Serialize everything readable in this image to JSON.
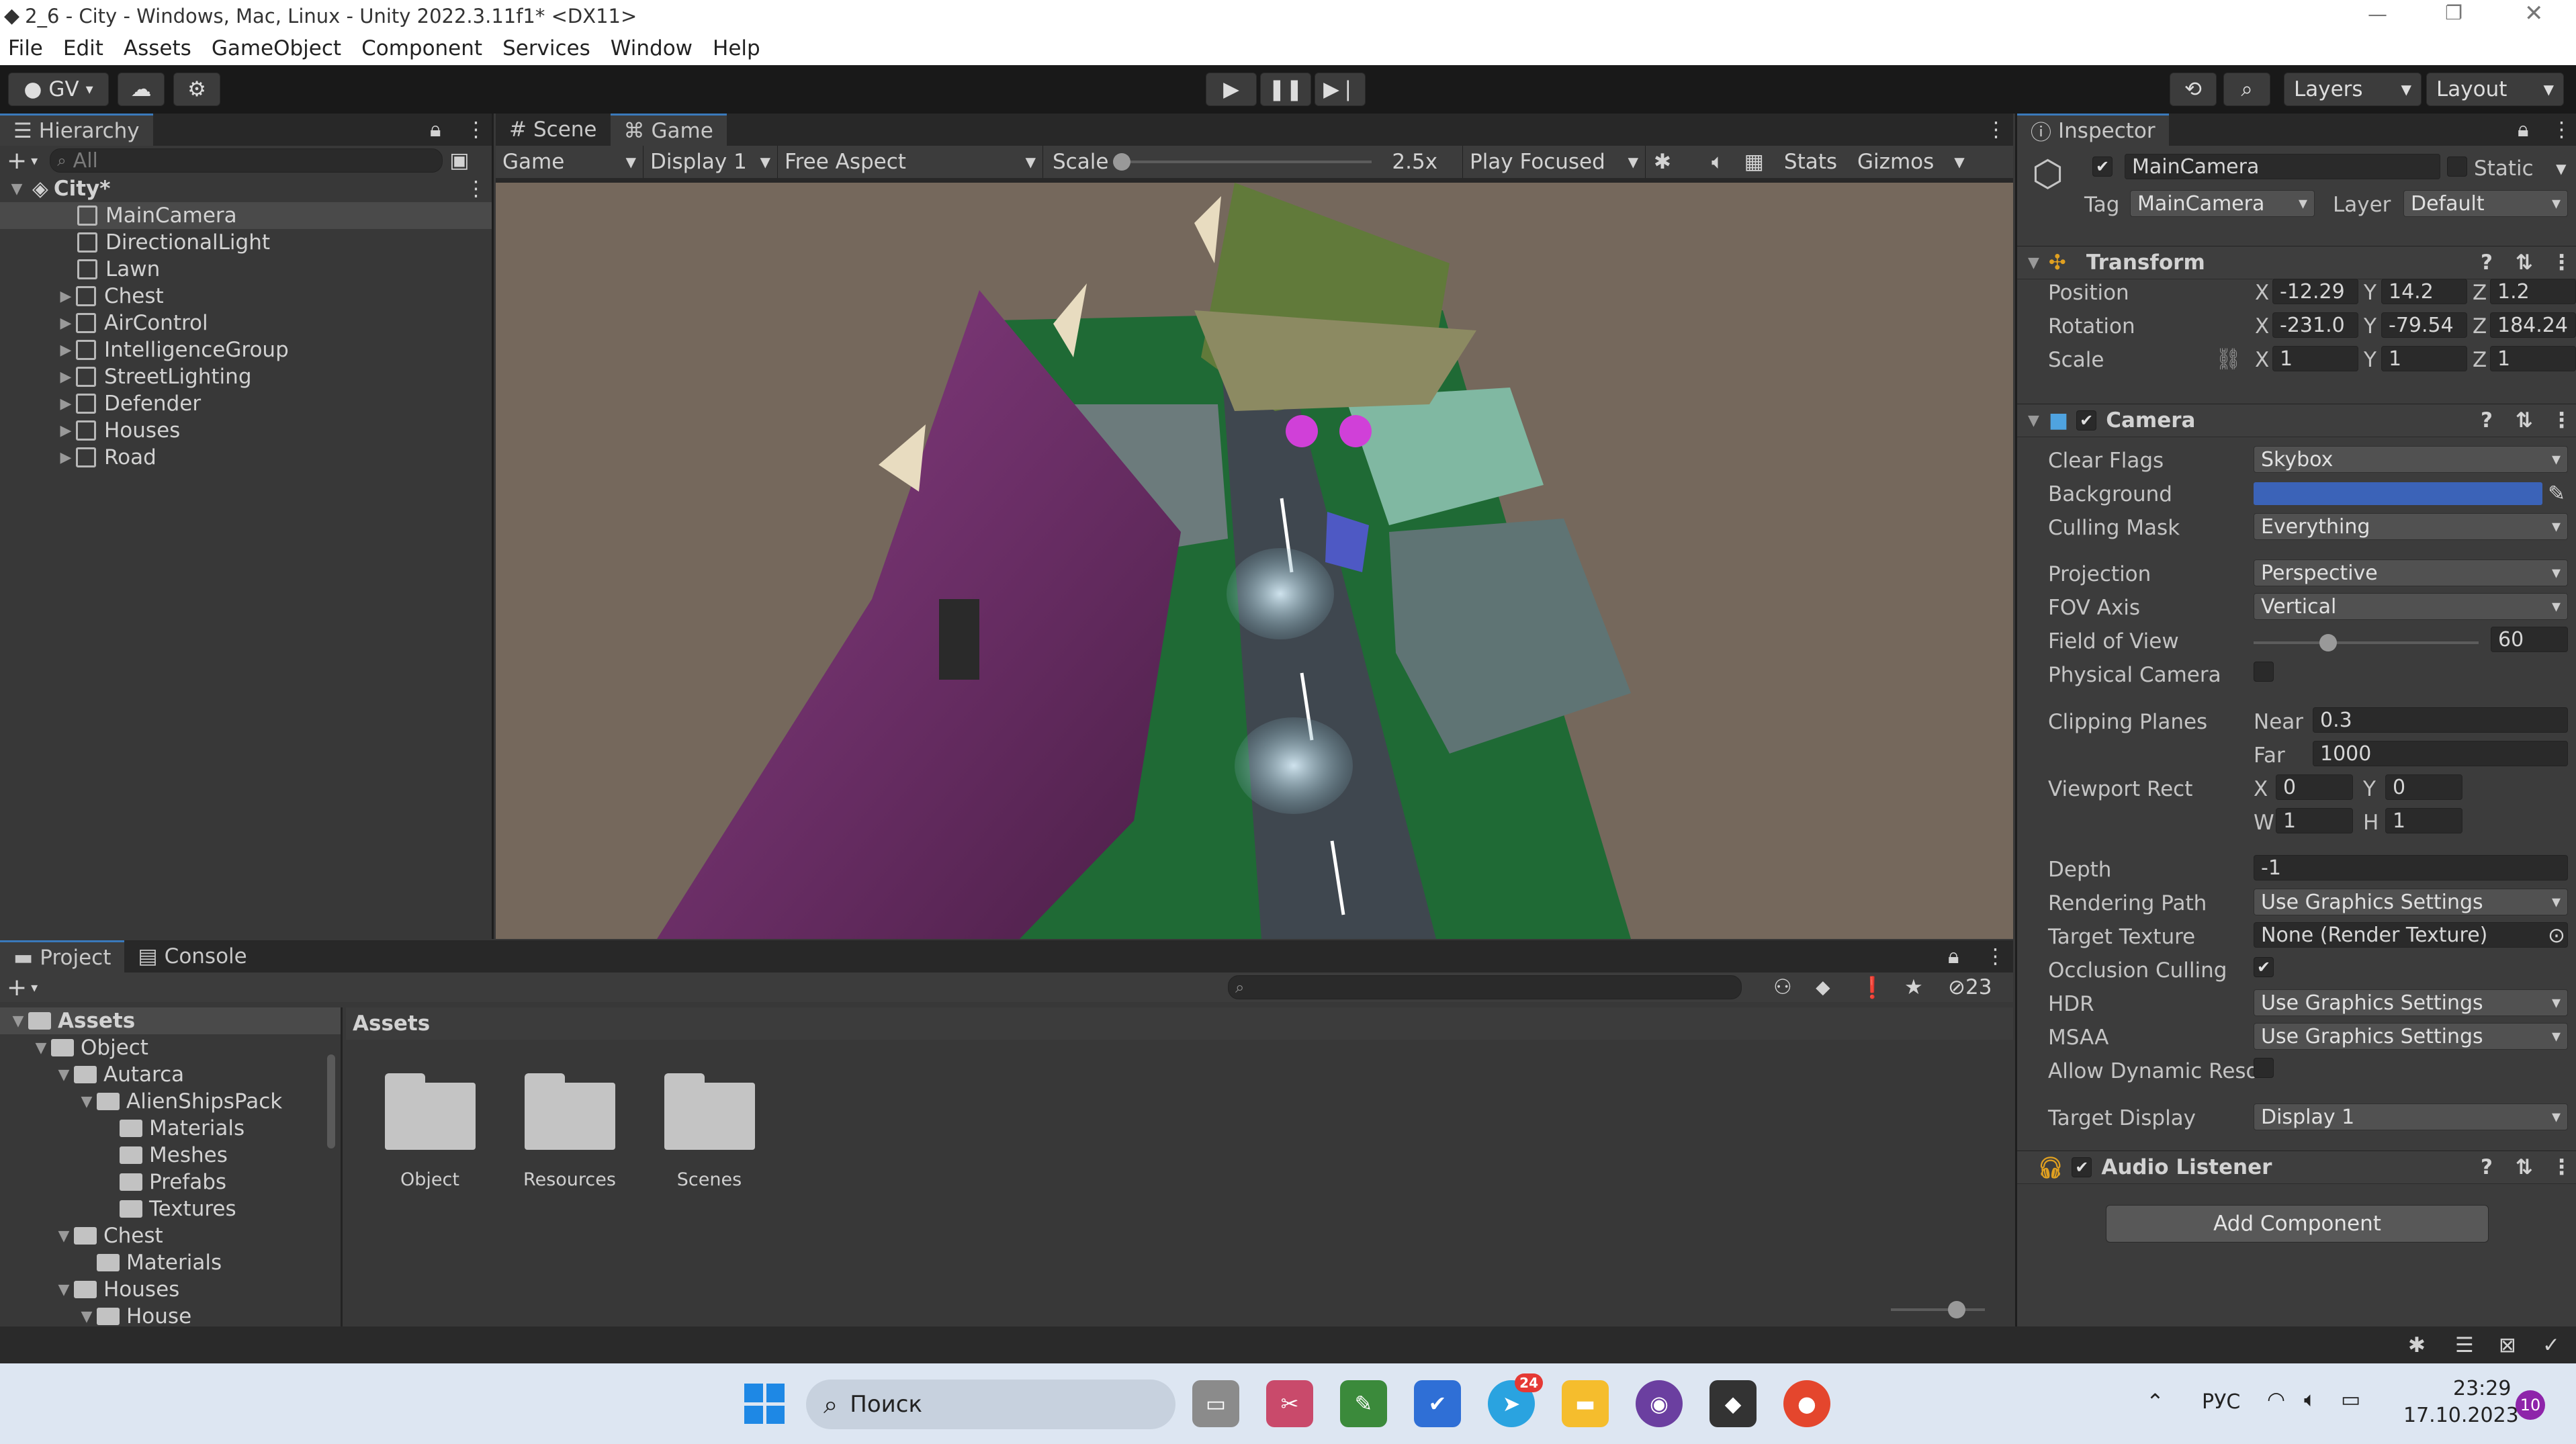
{
  "window": {
    "title": "2_6 - City - Windows, Mac, Linux - Unity 2022.3.11f1* <DX11>"
  },
  "menu": [
    "File",
    "Edit",
    "Assets",
    "GameObject",
    "Component",
    "Services",
    "Window",
    "Help"
  ],
  "toolbar": {
    "account": "GV",
    "layers": "Layers",
    "layout": "Layout"
  },
  "hierarchy": {
    "tab": "Hierarchy",
    "search_placeholder": "All",
    "scene": "City*",
    "items": [
      {
        "label": "MainCamera",
        "expandable": false
      },
      {
        "label": "DirectionalLight",
        "expandable": false
      },
      {
        "label": "Lawn",
        "expandable": false
      },
      {
        "label": "Chest",
        "expandable": true
      },
      {
        "label": "AirControl",
        "expandable": true
      },
      {
        "label": "IntelligenceGroup",
        "expandable": true
      },
      {
        "label": "StreetLighting",
        "expandable": true
      },
      {
        "label": "Defender",
        "expandable": true
      },
      {
        "label": "Houses",
        "expandable": true
      },
      {
        "label": "Road",
        "expandable": true
      }
    ]
  },
  "view": {
    "tabs": [
      "Scene",
      "Game"
    ],
    "game_dropdown": "Game",
    "display": "Display 1",
    "aspect": "Free Aspect",
    "scale_label": "Scale",
    "scale_value": "2.5x",
    "scale_level": 0.0,
    "play_mode": "Play Focused",
    "stats": "Stats",
    "gizmos": "Gizmos"
  },
  "inspector": {
    "tab": "Inspector",
    "object_name": "MainCamera",
    "static_label": "Static",
    "tag_label": "Tag",
    "tag": "MainCamera",
    "layer_label": "Layer",
    "layer": "Default",
    "transform": {
      "title": "Transform",
      "position": {
        "label": "Position",
        "x": "-12.29",
        "y": "14.2",
        "z": "1.2"
      },
      "rotation": {
        "label": "Rotation",
        "x": "-231.0",
        "y": "-79.54",
        "z": "184.24"
      },
      "scale": {
        "label": "Scale",
        "x": "1",
        "y": "1",
        "z": "1"
      }
    },
    "camera": {
      "title": "Camera",
      "clear_flags": {
        "label": "Clear Flags",
        "value": "Skybox"
      },
      "background": {
        "label": "Background",
        "color": "#3b63b8"
      },
      "culling_mask": {
        "label": "Culling Mask",
        "value": "Everything"
      },
      "projection": {
        "label": "Projection",
        "value": "Perspective"
      },
      "fov_axis": {
        "label": "FOV Axis",
        "value": "Vertical"
      },
      "field_of_view": {
        "label": "Field of View",
        "value": "60",
        "level": 0.33
      },
      "physical_camera": {
        "label": "Physical Camera"
      },
      "clipping": {
        "label": "Clipping Planes",
        "near_label": "Near",
        "near": "0.3",
        "far_label": "Far",
        "far": "1000"
      },
      "viewport": {
        "label": "Viewport Rect",
        "x": "0",
        "y": "0",
        "w": "1",
        "h": "1"
      },
      "depth": {
        "label": "Depth",
        "value": "-1"
      },
      "rendering_path": {
        "label": "Rendering Path",
        "value": "Use Graphics Settings"
      },
      "target_texture": {
        "label": "Target Texture",
        "value": "None (Render Texture)"
      },
      "occlusion_culling": {
        "label": "Occlusion Culling"
      },
      "hdr": {
        "label": "HDR",
        "value": "Use Graphics Settings"
      },
      "msaa": {
        "label": "MSAA",
        "value": "Use Graphics Settings"
      },
      "allow_dynamic": {
        "label": "Allow Dynamic Reso"
      },
      "target_display": {
        "label": "Target Display",
        "value": "Display 1"
      }
    },
    "audio_listener": {
      "title": "Audio Listener"
    },
    "add_component": "Add Component"
  },
  "project": {
    "tabs": [
      "Project",
      "Console"
    ],
    "hidden_count": "23",
    "breadcrumb": "Assets",
    "tree": [
      {
        "label": "Assets",
        "depth": 0,
        "bold": true
      },
      {
        "label": "Object",
        "depth": 1
      },
      {
        "label": "Autarca",
        "depth": 2
      },
      {
        "label": "AlienShipsPack",
        "depth": 3
      },
      {
        "label": "Materials",
        "depth": 4
      },
      {
        "label": "Meshes",
        "depth": 4
      },
      {
        "label": "Prefabs",
        "depth": 4
      },
      {
        "label": "Textures",
        "depth": 4
      },
      {
        "label": "Chest",
        "depth": 2
      },
      {
        "label": "Materials",
        "depth": 3
      },
      {
        "label": "Houses",
        "depth": 2
      },
      {
        "label": "House",
        "depth": 3
      }
    ],
    "folders": [
      "Object",
      "Resources",
      "Scenes"
    ]
  },
  "taskbar": {
    "search": "Поиск",
    "lang": "РУС",
    "time": "23:29",
    "date": "17.10.2023",
    "notif_count": "10",
    "telegram_badge": "24"
  }
}
